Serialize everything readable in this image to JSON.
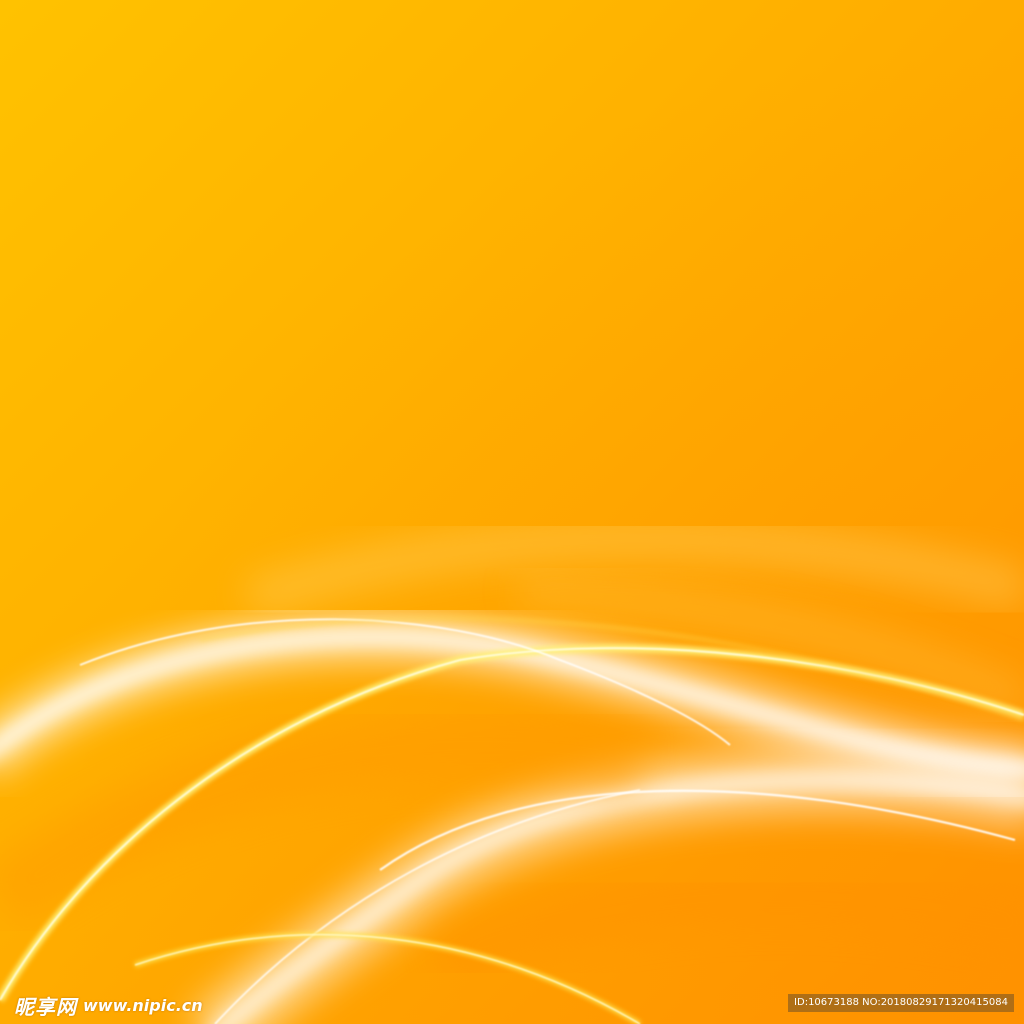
{
  "background": {
    "colors": [
      "#ffc200",
      "#ffae00",
      "#ff9500"
    ],
    "wave_colors": [
      "#ffffff",
      "#fff3a0",
      "#ffe34d"
    ]
  },
  "watermark": {
    "logo_text": "昵享网",
    "url_text": "www.nipic.cn",
    "id_text": "ID:10673188 NO:20180829171320415084"
  }
}
